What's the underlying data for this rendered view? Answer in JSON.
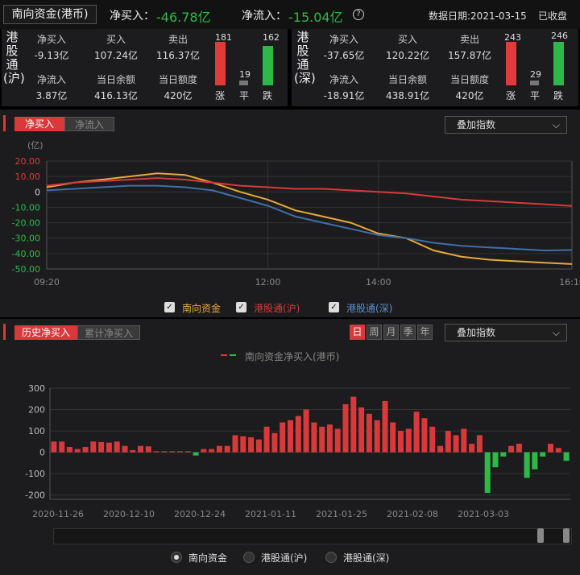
{
  "header": {
    "tab_label": "南向资金(港币)",
    "net_buy_label": "净买入：",
    "net_buy_value": "-46.78亿",
    "net_inflow_label": "净流入：",
    "net_inflow_value": "-15.04亿",
    "date_label": "数据日期:2021-03-15",
    "status": "已收盘"
  },
  "sh": {
    "name": "港股通(沪)",
    "net_buy_k": "净买入",
    "net_buy_v": "-9.13亿",
    "net_in_k": "净流入",
    "net_in_v": "3.87亿",
    "buy_k": "买入",
    "buy_v": "107.24亿",
    "sell_k": "卖出",
    "sell_v": "116.37亿",
    "bal_k": "当日余额",
    "bal_v": "416.13亿",
    "quota_k": "当日额度",
    "quota_v": "420亿",
    "up_n": "181",
    "flat_n": "19",
    "down_n": "162",
    "up_l": "涨",
    "flat_l": "平",
    "down_l": "跌"
  },
  "sz": {
    "name": "港股通(深)",
    "net_buy_k": "净买入",
    "net_buy_v": "-37.65亿",
    "net_in_k": "净流入",
    "net_in_v": "-18.91亿",
    "buy_k": "买入",
    "buy_v": "120.22亿",
    "sell_k": "卖出",
    "sell_v": "157.87亿",
    "bal_k": "当日余额",
    "bal_v": "438.91亿",
    "quota_k": "当日额度",
    "quota_v": "420亿",
    "up_n": "243",
    "flat_n": "29",
    "down_n": "246",
    "up_l": "涨",
    "flat_l": "平",
    "down_l": "跌"
  },
  "intraday_tabs": {
    "active": "净买入",
    "inactive": "净流入"
  },
  "overlay_label": "叠加指数",
  "history_tabs": {
    "active": "历史净买入",
    "inactive": "累计净买入"
  },
  "periods": [
    "日",
    "周",
    "月",
    "季",
    "年"
  ],
  "radio_options": [
    "南向资金",
    "港股通(沪)",
    "港股通(深)"
  ],
  "colors": {
    "up": "#e03a3a",
    "down": "#2fb84a",
    "south": "#e8a83a",
    "sh": "#d63a3a",
    "sz": "#3f6fa8"
  },
  "chart_data": [
    {
      "type": "line",
      "unit_label": "(亿)",
      "x_ticks": [
        "09:20",
        "12:00",
        "14:00",
        "16:10"
      ],
      "y_ticks": [
        "20.00",
        "10.00",
        "0",
        "-10.00",
        "-20.00",
        "-30.00",
        "-40.00",
        "-50.00"
      ],
      "ylim": [
        -50,
        20
      ],
      "x": [
        "09:20",
        "09:40",
        "10:00",
        "10:20",
        "10:40",
        "11:00",
        "11:20",
        "11:40",
        "12:00",
        "13:00",
        "13:20",
        "13:40",
        "14:00",
        "14:20",
        "14:40",
        "15:00",
        "15:20",
        "15:40",
        "16:00",
        "16:10"
      ],
      "series": [
        {
          "name": "南向资金",
          "values": [
            3,
            6,
            8,
            10,
            12,
            11,
            6,
            0,
            -5,
            -12,
            -16,
            -20,
            -27,
            -30,
            -38,
            -42,
            -44,
            -45,
            -46,
            -46.8
          ]
        },
        {
          "name": "港股通(沪)",
          "values": [
            4,
            6,
            7,
            8,
            9,
            8,
            6,
            4,
            3,
            2,
            2,
            1,
            0,
            -1,
            -3,
            -5,
            -6,
            -7,
            -8,
            -9.1
          ]
        },
        {
          "name": "港股通(深)",
          "values": [
            1,
            2,
            3,
            4,
            4,
            3,
            1,
            -4,
            -9,
            -16,
            -20,
            -24,
            -28,
            -30,
            -33,
            -35,
            -36,
            -37,
            -38,
            -37.7
          ]
        }
      ],
      "legend": "bottom"
    },
    {
      "type": "bar",
      "legend_label": "南向资金净买入(港币)",
      "y_ticks": [
        "300",
        "200",
        "100",
        "0",
        "-100",
        "-200"
      ],
      "ylim": [
        -220,
        300
      ],
      "x_ticks": [
        "2020-11-26",
        "2020-12-10",
        "2020-12-24",
        "2021-01-11",
        "2021-01-25",
        "2021-02-08",
        "2021-03-03"
      ],
      "values": [
        50,
        50,
        25,
        15,
        25,
        50,
        48,
        45,
        50,
        30,
        10,
        30,
        28,
        5,
        5,
        5,
        5,
        5,
        -15,
        15,
        15,
        30,
        30,
        80,
        75,
        70,
        60,
        120,
        90,
        140,
        150,
        170,
        200,
        140,
        120,
        130,
        110,
        225,
        260,
        210,
        180,
        150,
        240,
        140,
        100,
        110,
        190,
        160,
        120,
        30,
        100,
        80,
        110,
        40,
        80,
        -190,
        -70,
        -20,
        30,
        40,
        -120,
        -80,
        -20,
        40,
        20,
        -40
      ]
    }
  ]
}
